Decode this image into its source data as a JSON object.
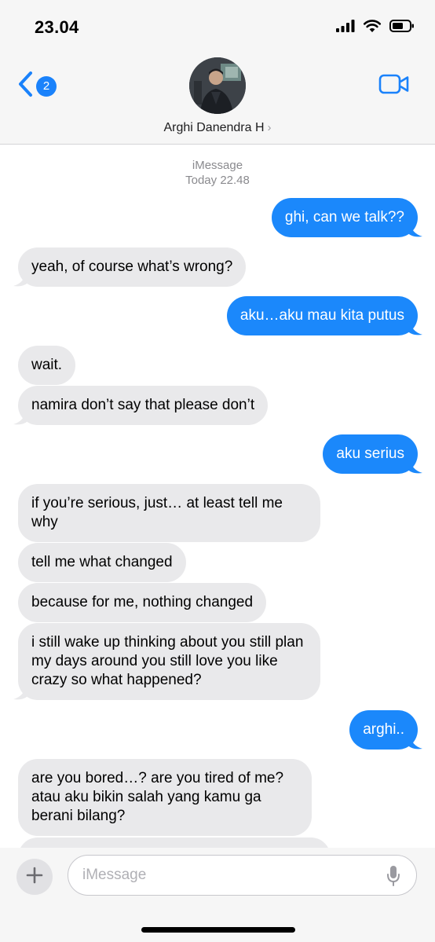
{
  "status_bar": {
    "time": "23.04"
  },
  "header": {
    "back_badge": "2",
    "contact_name": "Arghi Danendra H",
    "contact_chevron": "›"
  },
  "thread": {
    "service": "iMessage",
    "timestamp": "Today 22.48",
    "messages": [
      {
        "from": "me",
        "text": "ghi, can we talk??"
      },
      {
        "from": "them",
        "text": "yeah, of course what’s wrong?"
      },
      {
        "from": "me",
        "text": "aku…aku mau kita putus"
      },
      {
        "from": "them",
        "text": "wait."
      },
      {
        "from": "them",
        "text": "namira don’t say that please don’t"
      },
      {
        "from": "me",
        "text": "aku serius"
      },
      {
        "from": "them",
        "text": "if you’re serious, just… at least tell me why"
      },
      {
        "from": "them",
        "text": "tell me what changed"
      },
      {
        "from": "them",
        "text": "because for me, nothing changed"
      },
      {
        "from": "them",
        "text": "i still wake up thinking about you still plan my days around you still love you like crazy so what happened?"
      },
      {
        "from": "me",
        "text": "arghi.."
      },
      {
        "from": "them",
        "text": "are you bored…? are you tired of me? atau aku bikin salah yang kamu ga berani bilang?"
      }
    ]
  },
  "compose": {
    "placeholder": "iMessage"
  },
  "icons": {
    "back": "chevron-left-icon",
    "video": "video-camera-icon",
    "plus": "plus-icon",
    "mic": "microphone-icon",
    "signal": "cellular-signal-icon",
    "wifi": "wifi-icon",
    "battery": "battery-icon"
  },
  "colors": {
    "accent": "#1a82fb",
    "outgoing_bubble": "#1b88fb",
    "incoming_bubble": "#e9e9eb",
    "bar_background": "#f6f6f6"
  }
}
